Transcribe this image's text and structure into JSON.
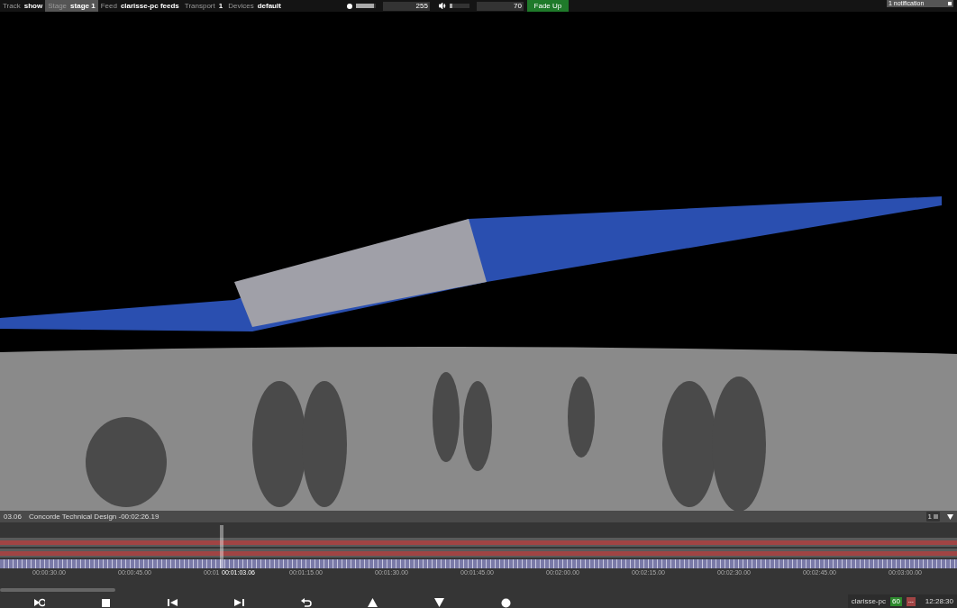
{
  "top_bar": {
    "fields": [
      {
        "label": "Track",
        "value": "show",
        "selected": false
      },
      {
        "label": "Stage",
        "value": "stage 1",
        "selected": true
      },
      {
        "label": "Feed",
        "value": "clarisse-pc feeds",
        "selected": false
      },
      {
        "label": "Transport",
        "value": "1",
        "selected": false
      },
      {
        "label": "Devices",
        "value": "default",
        "selected": false
      }
    ],
    "brightness": {
      "level": 0.9,
      "value": "255"
    },
    "volume": {
      "level": 0.15,
      "value": "70"
    },
    "fade_button": "Fade Up",
    "notification": "1 notification"
  },
  "timeline": {
    "current_time": "03.06",
    "cue_title": "Concorde Technical Design -00:02:26.19",
    "page_number": "1",
    "playhead_label": "00:01:03.06",
    "ticks": [
      "00:00:30.00",
      "00:00:45.00",
      "00:01",
      "00:01:15.00",
      "00:01:30.00",
      "00:01:45.00",
      "00:02:00.00",
      "00:02:15.00",
      "00:02:30.00",
      "00:02:45.00",
      "00:03:00.00"
    ]
  },
  "transport": [
    {
      "kind": "loop"
    },
    {
      "kind": "stop"
    },
    {
      "kind": "prev"
    },
    {
      "kind": "next"
    },
    {
      "kind": "undo"
    },
    {
      "kind": "up"
    },
    {
      "kind": "down"
    },
    {
      "kind": "record"
    }
  ],
  "status": {
    "machine": "clarisse-pc",
    "fps": "60",
    "dropped": "---",
    "clock": "12:28:30"
  }
}
